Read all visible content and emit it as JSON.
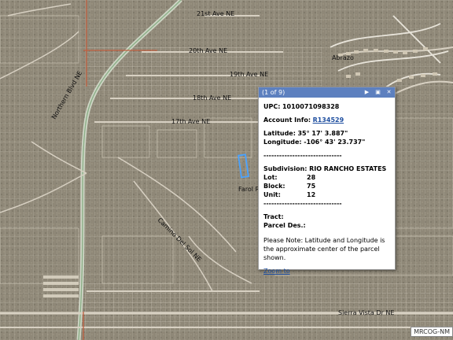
{
  "streets": {
    "s1": "21st Ave NE",
    "s2": "20th Ave NE",
    "s3": "19th Ave NE",
    "s4": "18th Ave NE",
    "s5": "17th Ave NE",
    "s6": "Northern Blvd NE",
    "s7": "Abrazo",
    "s8": "Camino Del Sol NE",
    "s9": "Farol Rd NE",
    "s10": "Sierra Vista Dr NE"
  },
  "popup": {
    "counter": "(1 of 9)",
    "upc_label": "UPC:",
    "upc_value": "1010071098328",
    "account_label": "Account Info:",
    "account_link": "R134529",
    "lat_label": "Latitude:",
    "lat_value": "35° 17' 3.887\"",
    "lon_label": "Longitude:",
    "lon_value": "-106° 43' 23.737\"",
    "divider": "------------------------------",
    "subdivision_label": "Subdivision:",
    "subdivision_value": "RIO RANCHO ESTATES",
    "lot_label": "Lot:",
    "lot_value": "28",
    "block_label": "Block:",
    "block_value": "75",
    "unit_label": "Unit:",
    "unit_value": "12",
    "divider2": "------------------------------",
    "tract_label": "Tract:",
    "parcel_label": "Parcel Des.:",
    "note": "Please Note: Latitude and Longitude is the approximate center of the parcel shown.",
    "zoom_link": "Zoom to"
  },
  "attribution": "MRCOG-NM",
  "colors": {
    "header": "#5d80bf",
    "road_highlight": "#c06040",
    "parcel_select": "#4aa3ff",
    "terrain": "#8a8474"
  }
}
